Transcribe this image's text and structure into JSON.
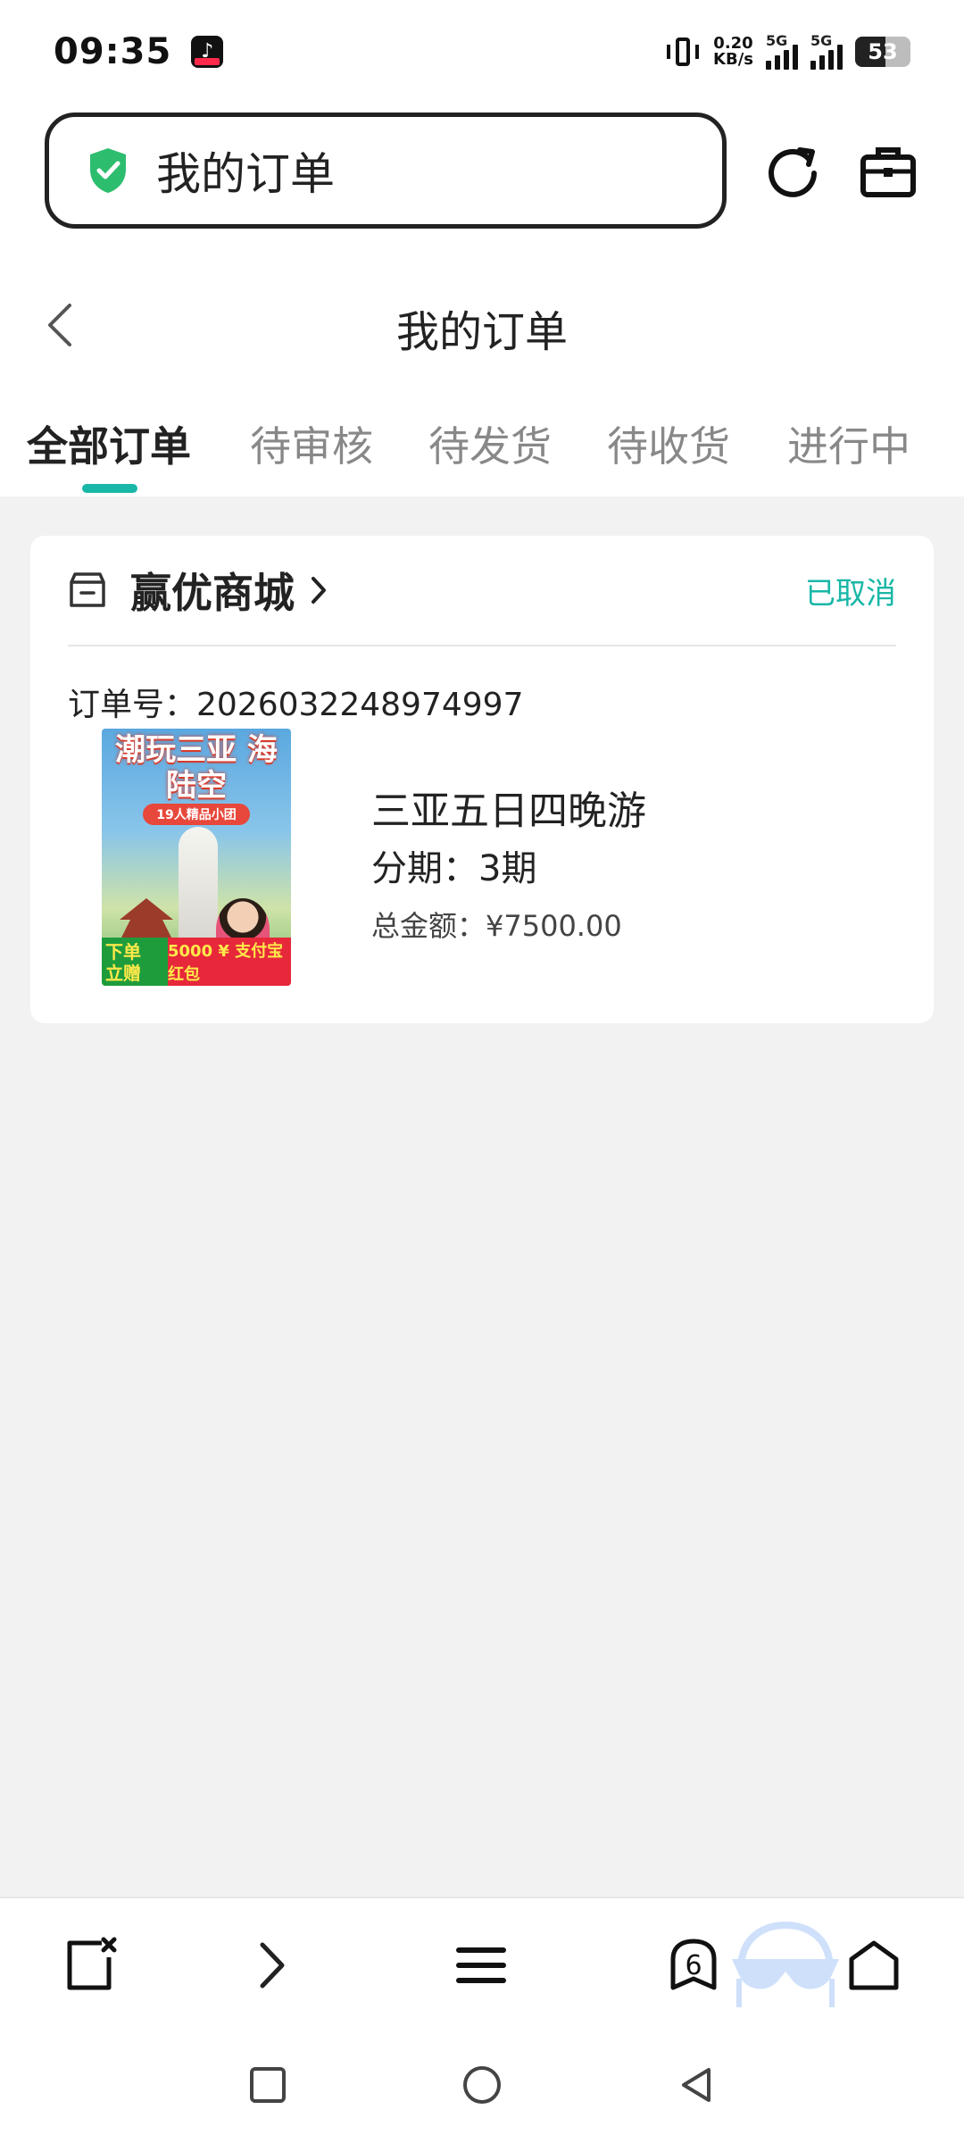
{
  "status_bar": {
    "time": "09:35",
    "net_speed_value": "0.20",
    "net_speed_unit": "KB/s",
    "signal1_label": "5G",
    "signal2_label": "5G",
    "battery": "53"
  },
  "browser": {
    "url_text": "我的订单"
  },
  "header": {
    "title": "我的订单"
  },
  "tabs": [
    {
      "label": "全部订单",
      "active": true
    },
    {
      "label": "待审核",
      "active": false
    },
    {
      "label": "待发货",
      "active": false
    },
    {
      "label": "待收货",
      "active": false
    },
    {
      "label": "进行中",
      "active": false
    }
  ],
  "order": {
    "shop_name": "赢优商城",
    "status": "已取消",
    "order_no": "订单号：2026032248974997",
    "product_name": "三亚五日四晚游",
    "installment": "分期：3期",
    "total": "总金额：¥7500.00",
    "image": {
      "banner": "潮玩三亚 海陆空",
      "chip": "19人精品小团",
      "promo_left": "下单 立赠",
      "promo_right": "5000 ¥ 支付宝红包"
    }
  },
  "bottom_nav": {
    "tabs_count": "6"
  },
  "colors": {
    "accent": "#19b7a7",
    "shield": "#2dbd6e"
  }
}
